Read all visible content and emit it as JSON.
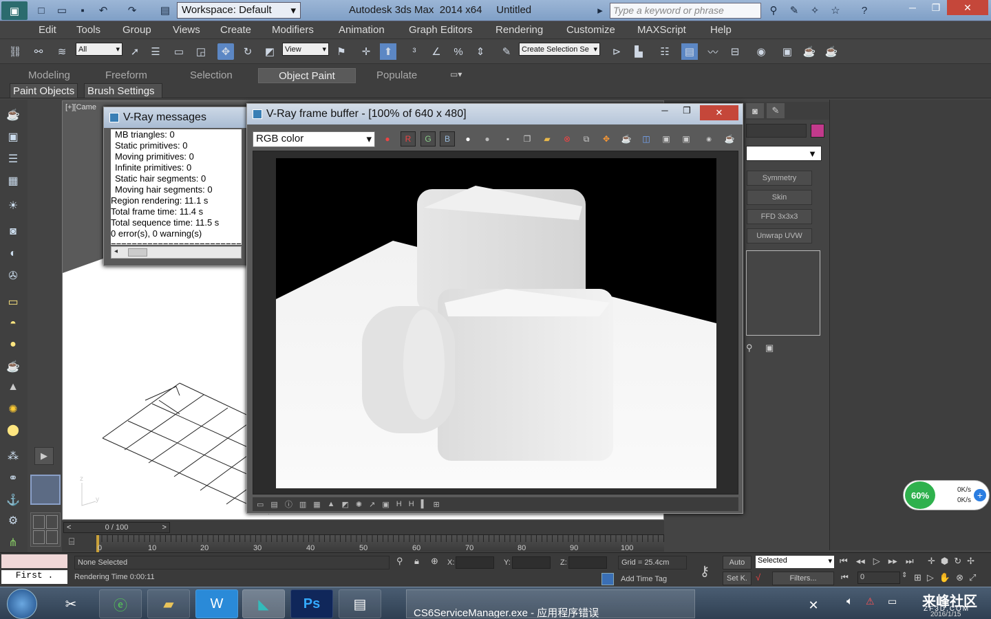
{
  "titlebar": {
    "workspace": "Workspace: Default",
    "app_title": "Autodesk 3ds Max  2014 x64     Untitled",
    "search_placeholder": "Type a keyword or phrase"
  },
  "menu": [
    "Edit",
    "Tools",
    "Group",
    "Views",
    "Create",
    "Modifiers",
    "Animation",
    "Graph Editors",
    "Rendering",
    "Customize",
    "MAXScript",
    "Help"
  ],
  "toolbar": {
    "selection_filter": "All",
    "ref_coord": "View",
    "named_selection": "Create Selection Se"
  },
  "ribbon": {
    "tabs": [
      "Modeling",
      "Freeform",
      "Selection",
      "Object Paint",
      "Populate"
    ],
    "active_tab": "Object Paint",
    "subtabs": [
      "Paint Objects",
      "Brush Settings"
    ]
  },
  "viewport": {
    "label": "[+][Came"
  },
  "vray_messages": {
    "title": "V-Ray messages",
    "lines": [
      "MB triangles: 0",
      "Static primitives: 0",
      "Moving primitives: 0",
      "Infinite primitives: 0",
      "Static hair segments: 0",
      "Moving hair segments: 0",
      "Region rendering: 11.1 s",
      "Total frame time: 11.4 s",
      "Total sequence time: 11.5 s",
      "0 error(s), 0 warning(s)",
      "============================"
    ]
  },
  "frame_buffer": {
    "title": "V-Ray frame buffer - [100% of 640 x 480]",
    "channel": "RGB color",
    "r": "R",
    "g": "G",
    "b": "B"
  },
  "modifiers": [
    "Symmetry",
    "Skin",
    "FFD 3x3x3",
    "Unwrap UVW"
  ],
  "timeline": {
    "frame_counter": "0 / 100",
    "ticks": [
      "0",
      "10",
      "20",
      "30",
      "40",
      "50",
      "60",
      "70",
      "80",
      "90",
      "100"
    ]
  },
  "status": {
    "selection": "None Selected",
    "render_time": "Rendering Time  0:00:11",
    "x_label": "X:",
    "y_label": "Y:",
    "z_label": "Z:",
    "grid": "Grid = 25.4cm",
    "add_time_tag": "Add Time Tag",
    "auto": "Auto",
    "set_key": "Set K.",
    "key_filter": "Selected",
    "filters": "Filters...",
    "frame": "0",
    "maxscript_text": "First ."
  },
  "network": {
    "percent": "60%",
    "up": "0K/s",
    "down": "0K/s"
  },
  "taskbar": {
    "error_window": "CS6ServiceManager.exe - 应用程序错误",
    "watermark": "来峰社区",
    "watermark_sub": "ZF3D.COM",
    "date": "2016/1/15"
  }
}
